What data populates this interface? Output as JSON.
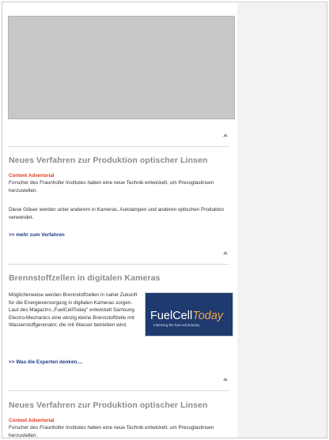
{
  "articles": [
    {
      "headline": "Neues Verfahren zur Produktion optischer Linsen",
      "tag": "Content Advertorial",
      "paragraphs": [
        "Forscher des Fraunhofer Institutes haben eine neue Technik entwickelt, um Pressglaslinsen herzustellen.",
        "Diese Gläser werden unter anderem in Kameras, Autolampen und anderen optischen Produkten verwendet."
      ],
      "more_link": ">> mehr zum Verfahren"
    },
    {
      "headline": "Brennstoffzellen in digitalen Kameras",
      "paragraphs": [
        "Möglicherweise werden Brennstoffzellen in naher Zukunft für die Energieversorgung in digitalen Kameras sorgen. Laut des Magazins „FuelCellToday\" entwickelt Samsung Electro-Mechanics eine winzig kleine Brennstoffzelle mit Wasserstoffgenerator, die mit Wasser betrieben wird."
      ],
      "more_link": ">> Was die Experten denken....",
      "logo": {
        "brand_part1": "FuelCell",
        "brand_part2": "Today",
        "slogan": "Informing the fuel cell industry"
      }
    },
    {
      "headline": "Neues Verfahren zur Produktion optischer Linsen",
      "tag": "Content Advertorial",
      "paragraphs": [
        "Forscher des Fraunhofer Institutes haben eine neue Technik entwickelt, um Pressglaslinsen herzustellen."
      ]
    }
  ],
  "icons": {
    "back_to_top": "triangle-up-icon"
  },
  "colors": {
    "headline": "#8c8c8c",
    "advertorial_tag": "#e03c1e",
    "link": "#1a3a8a",
    "logo_bg": "#1f3a6e",
    "logo_accent": "#f3a64d",
    "sidebar_bg": "#f2f2f2",
    "banner_placeholder": "#c8c8c8"
  }
}
